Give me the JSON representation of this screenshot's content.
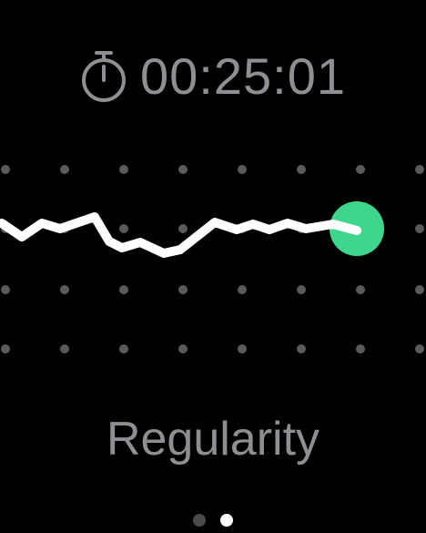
{
  "workout": {
    "elapsed_time": "00:25:01",
    "timer_icon": "stopwatch-icon",
    "metric_label": "Regularity"
  },
  "regularity_graph": {
    "line_color": "#ffffff",
    "marker_color": "#3dd68c",
    "grid_dot_color": "#5a5a5a",
    "marker_icon": "current-position-marker"
  },
  "pagination": {
    "page_count": 2,
    "current_page": 2
  },
  "colors": {
    "background": "#000000",
    "text": "#8e8e93",
    "accent": "#3dd68c"
  }
}
